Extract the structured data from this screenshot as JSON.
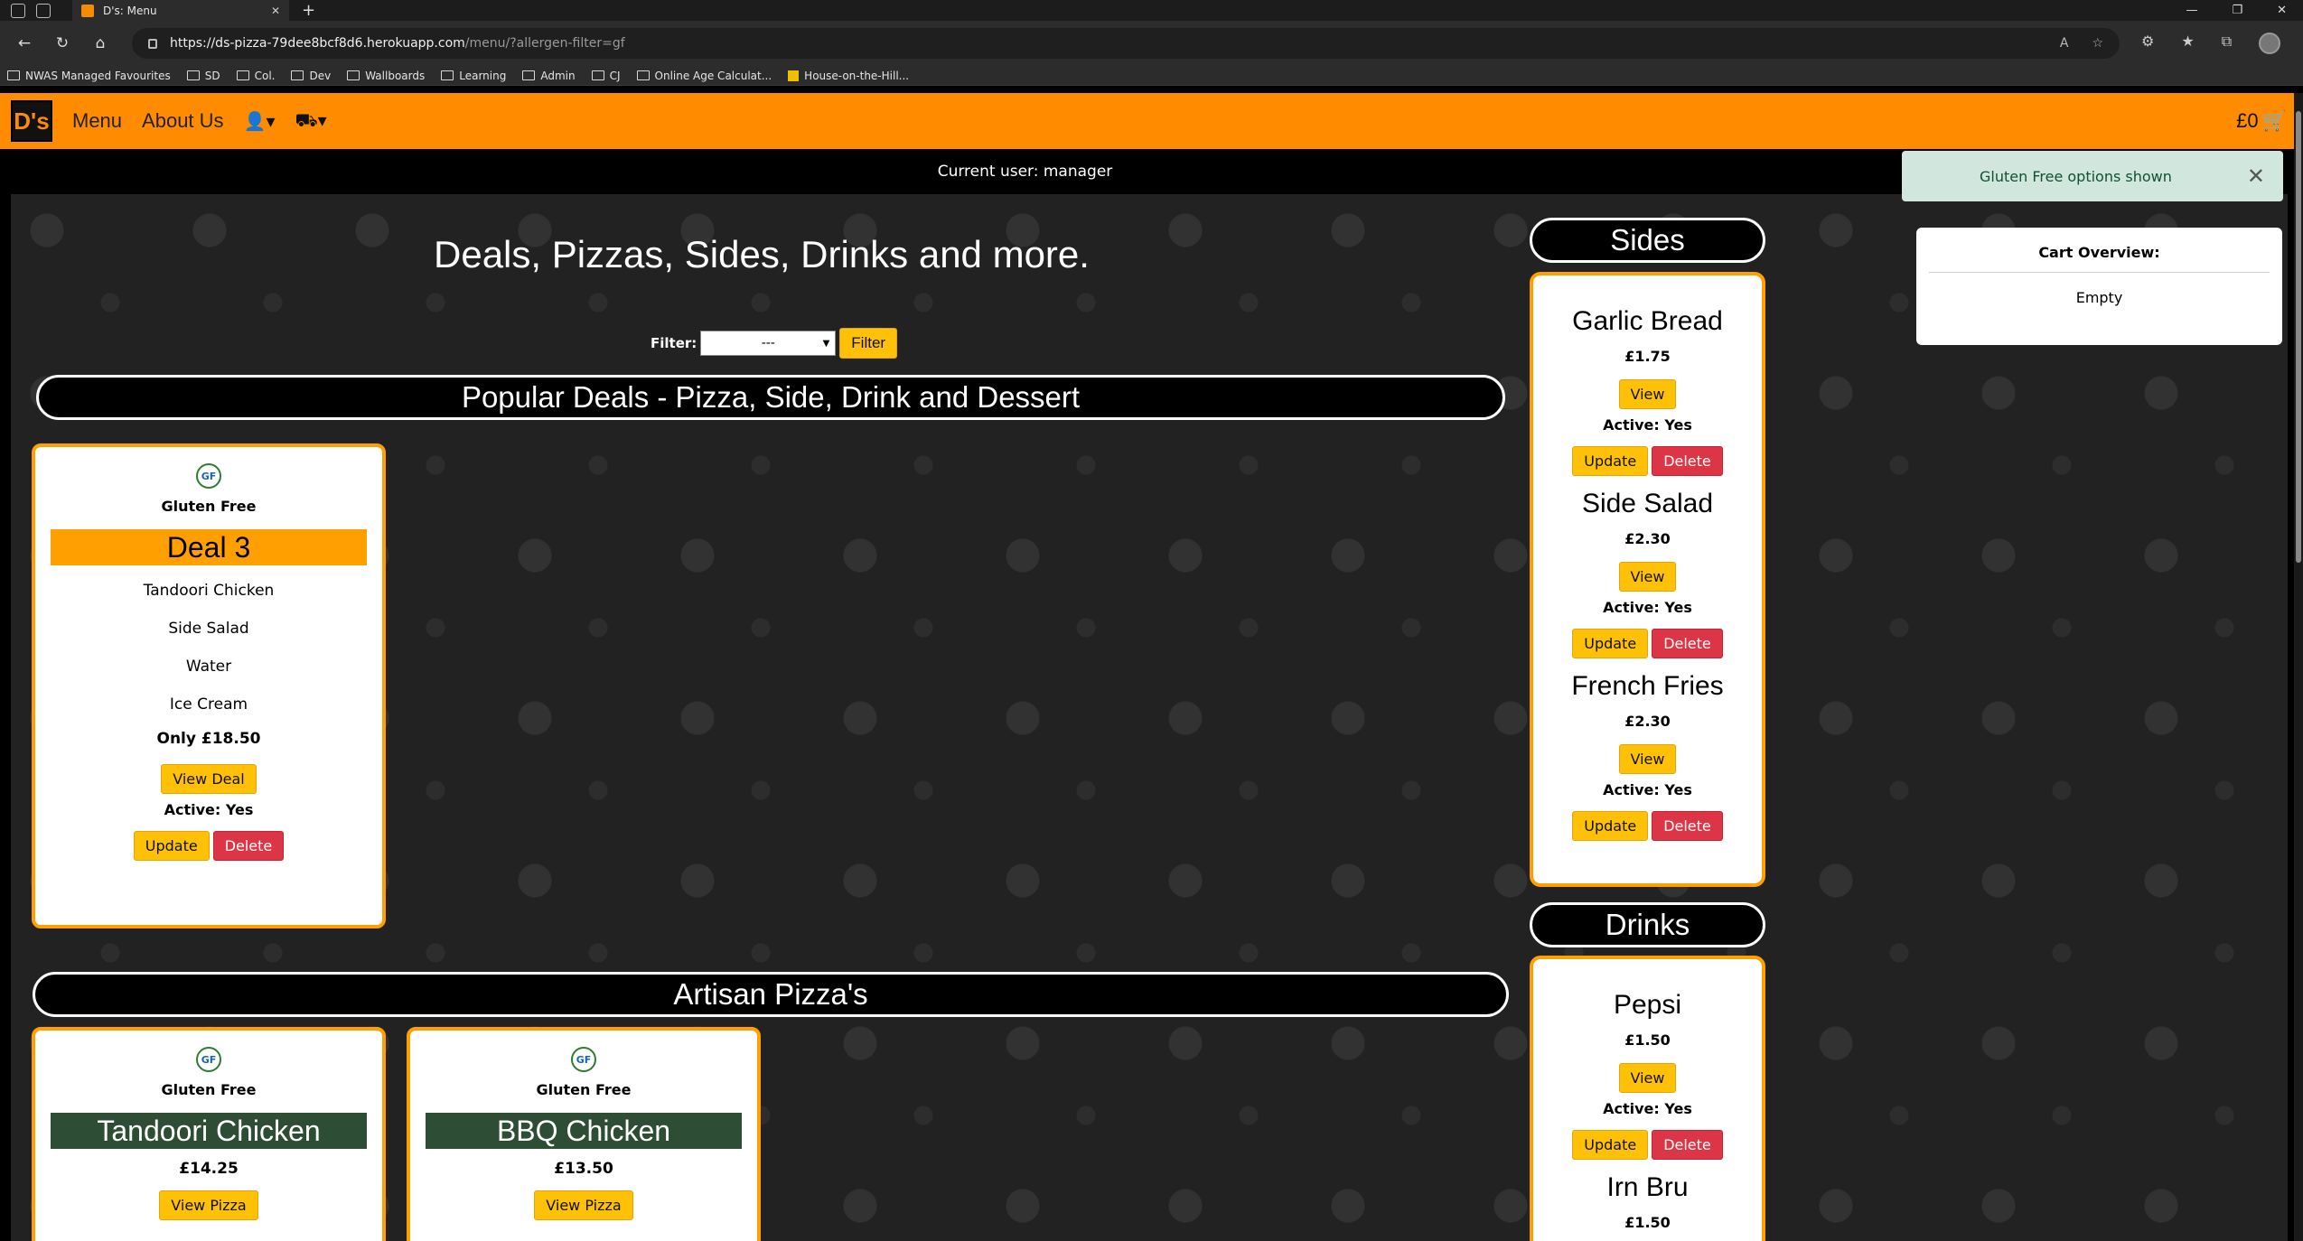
{
  "browser": {
    "tab_title": "D's: Menu",
    "url_host": "https://ds-pizza-79dee8bcf8d6.herokuapp.com",
    "url_path": "/menu/?allergen-filter=gf",
    "favourites": [
      "NWAS Managed Favourites",
      "SD",
      "Col.",
      "Dev",
      "Wallboards",
      "Learning",
      "Admin",
      "CJ",
      "Online Age Calculat...",
      "House-on-the-Hill..."
    ]
  },
  "nav": {
    "logo": "D's",
    "menu": "Menu",
    "about": "About Us",
    "cart_total": "£0"
  },
  "user_bar": "Current user: manager",
  "toast": "Gluten Free options shown",
  "cart_overview": {
    "title": "Cart Overview:",
    "status": "Empty"
  },
  "headline": "Deals, Pizzas, Sides, Drinks and more.",
  "filter": {
    "label": "Filter:",
    "selected": "---",
    "button": "Filter"
  },
  "deals_section": {
    "heading": "Popular Deals - Pizza, Side, Drink and Dessert",
    "deal": {
      "badge": "GF",
      "tag": "Gluten Free",
      "name": "Deal 3",
      "items": [
        "Tandoori Chicken",
        "Side Salad",
        "Water",
        "Ice Cream"
      ],
      "price": "Only £18.50",
      "view": "View Deal",
      "active": "Active: Yes",
      "update": "Update",
      "delete": "Delete"
    }
  },
  "pizza_section": {
    "heading": "Artisan Pizza's",
    "pizzas": [
      {
        "badge": "GF",
        "tag": "Gluten Free",
        "name": "Tandoori Chicken",
        "price": "£14.25",
        "view": "View Pizza"
      },
      {
        "badge": "GF",
        "tag": "Gluten Free",
        "name": "BBQ Chicken",
        "price": "£13.50",
        "view": "View Pizza"
      }
    ]
  },
  "sides": {
    "heading": "Sides",
    "items": [
      {
        "name": "Garlic Bread",
        "price": "£1.75",
        "view": "View",
        "active": "Active: Yes",
        "update": "Update",
        "delete": "Delete"
      },
      {
        "name": "Side Salad",
        "price": "£2.30",
        "view": "View",
        "active": "Active: Yes",
        "update": "Update",
        "delete": "Delete"
      },
      {
        "name": "French Fries",
        "price": "£2.30",
        "view": "View",
        "active": "Active: Yes",
        "update": "Update",
        "delete": "Delete"
      }
    ]
  },
  "drinks": {
    "heading": "Drinks",
    "items": [
      {
        "name": "Pepsi",
        "price": "£1.50",
        "view": "View",
        "active": "Active: Yes",
        "update": "Update",
        "delete": "Delete"
      },
      {
        "name": "Irn Bru",
        "price": "£1.50"
      }
    ]
  },
  "colors": {
    "brand": "#ff8c00",
    "button": "#ffc107",
    "danger": "#dc3545",
    "pizza_bar": "#2e4d35",
    "toast_bg": "#d1e7dd"
  }
}
